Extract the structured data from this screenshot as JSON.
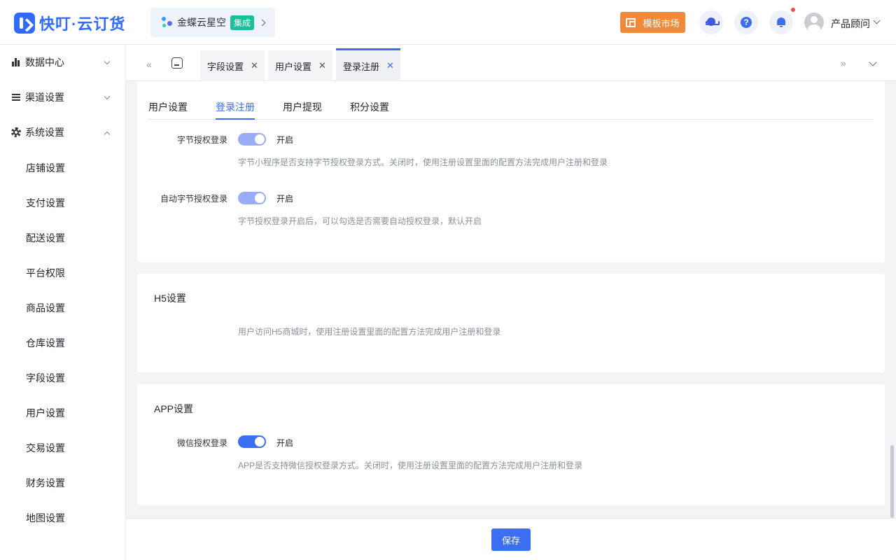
{
  "header": {
    "brand": "快叮·云订货",
    "kingdee": {
      "label": "金蝶云星空",
      "badge": "集成"
    },
    "template_market": "模板市场",
    "user_name": "产品顾问"
  },
  "sidebar": {
    "groups": [
      {
        "label": "数据中心",
        "expanded": false,
        "icon": "bar-chart-icon"
      },
      {
        "label": "渠道设置",
        "expanded": false,
        "icon": "list-icon"
      },
      {
        "label": "系统设置",
        "expanded": true,
        "icon": "gear-icon"
      }
    ],
    "items": [
      "店铺设置",
      "支付设置",
      "配送设置",
      "平台权限",
      "商品设置",
      "仓库设置",
      "字段设置",
      "用户设置",
      "交易设置",
      "财务设置",
      "地图设置"
    ]
  },
  "tabs": [
    {
      "label": "字段设置",
      "active": false
    },
    {
      "label": "用户设置",
      "active": false
    },
    {
      "label": "登录注册",
      "active": true
    }
  ],
  "subtabs": [
    {
      "label": "用户设置",
      "active": false
    },
    {
      "label": "登录注册",
      "active": true
    },
    {
      "label": "用户提现",
      "active": false
    },
    {
      "label": "积分设置",
      "active": false
    }
  ],
  "bytedance": {
    "auth_label": "字节授权登录",
    "auth_state": "开启",
    "auth_hint": "字节小程序是否支持字节授权登录方式。关闭时，使用注册设置里面的配置方法完成用户注册和登录",
    "auto_label": "自动字节授权登录",
    "auto_state": "开启",
    "auto_hint": "字节授权登录开启后，可以勾选是否需要自动授权登录，默认开启"
  },
  "h5": {
    "title": "H5设置",
    "hint": "用户访问H5商城时，使用注册设置里面的配置方法完成用户注册和登录"
  },
  "app": {
    "title": "APP设置",
    "wechat_label": "微信授权登录",
    "wechat_state": "开启",
    "wechat_hint": "APP是否支持微信授权登录方式。关闭时，使用注册设置里面的配置方法完成用户注册和登录"
  },
  "footer": {
    "save": "保存"
  },
  "colors": {
    "primary": "#3b6ef0",
    "switch_disabled": "#99adf7",
    "template_btn": "#f08a3a",
    "badge": "#1bbf9a"
  }
}
